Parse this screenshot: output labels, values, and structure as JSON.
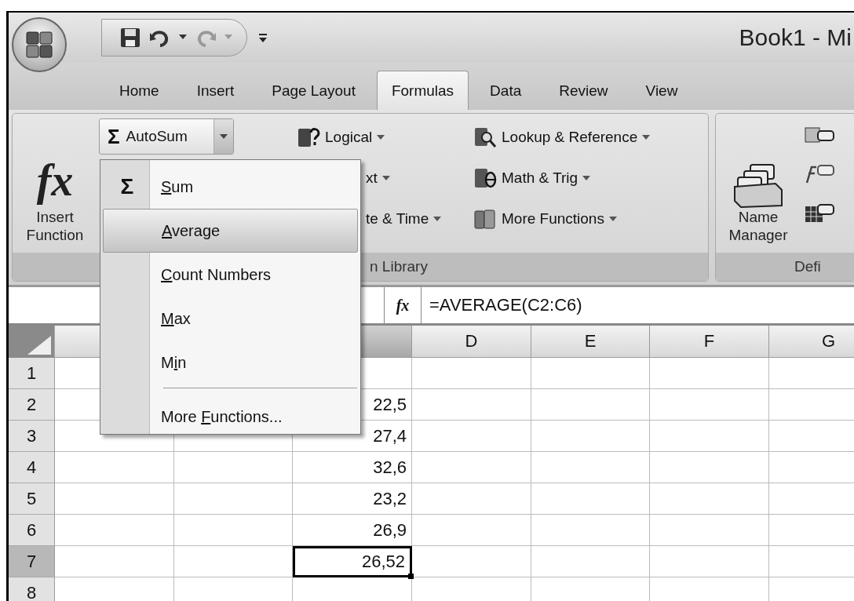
{
  "window": {
    "title": "Book1 - Mi"
  },
  "tabs": [
    {
      "label": "Home",
      "selected": false
    },
    {
      "label": "Insert",
      "selected": false
    },
    {
      "label": "Page Layout",
      "selected": false
    },
    {
      "label": "Formulas",
      "selected": true
    },
    {
      "label": "Data",
      "selected": false
    },
    {
      "label": "Review",
      "selected": false
    },
    {
      "label": "View",
      "selected": false
    }
  ],
  "function_library": {
    "label": "n Library",
    "insert_function": {
      "symbol": "fx",
      "label": "Insert Function"
    },
    "autosum": {
      "symbol": "Σ",
      "label": "AutoSum"
    },
    "commands": [
      {
        "kind": "book-question",
        "label": "Logical"
      },
      {
        "kind": "none",
        "label": "xt"
      },
      {
        "kind": "none",
        "label": "te & Time"
      },
      {
        "kind": "book-search",
        "label": "Lookup & Reference"
      },
      {
        "kind": "book-theta",
        "label": "Math & Trig"
      },
      {
        "kind": "books",
        "label": "More Functions"
      }
    ]
  },
  "defined_names": {
    "label": "Defi",
    "name_manager": "Name Manager"
  },
  "formula_bar": {
    "fx": "fx",
    "formula": "=AVERAGE(C2:C6)"
  },
  "columns": [
    {
      "selected": true
    },
    {
      "label": "D",
      "selected": false
    },
    {
      "label": "E",
      "selected": false
    },
    {
      "label": "F",
      "selected": false
    },
    {
      "label": "G",
      "selected": false
    }
  ],
  "rows": [
    {
      "label": "1",
      "selected": false
    },
    {
      "label": "2",
      "selected": false,
      "c": "22,5"
    },
    {
      "label": "3",
      "selected": false,
      "c": "27,4"
    },
    {
      "label": "4",
      "selected": false,
      "c": "32,6"
    },
    {
      "label": "5",
      "selected": false,
      "c": "23,2"
    },
    {
      "label": "6",
      "selected": false,
      "c": "26,9"
    },
    {
      "label": "7",
      "selected": true,
      "active": true,
      "c": "26,52"
    },
    {
      "label": "8",
      "selected": false
    }
  ],
  "autosum_menu": [
    {
      "kind": "item",
      "symbol": "Σ",
      "key": "S",
      "after": "um",
      "selected": false
    },
    {
      "kind": "item",
      "key": "A",
      "after": "verage",
      "selected": true
    },
    {
      "kind": "item",
      "key": "C",
      "after": "ount Numbers",
      "selected": false
    },
    {
      "kind": "item",
      "key": "M",
      "after": "ax",
      "selected": false
    },
    {
      "kind": "item",
      "before": "M",
      "key": "i",
      "after": "n",
      "selected": false
    },
    {
      "kind": "separator"
    },
    {
      "kind": "item",
      "before": "More ",
      "key": "F",
      "after": "unctions...",
      "selected": false
    }
  ]
}
